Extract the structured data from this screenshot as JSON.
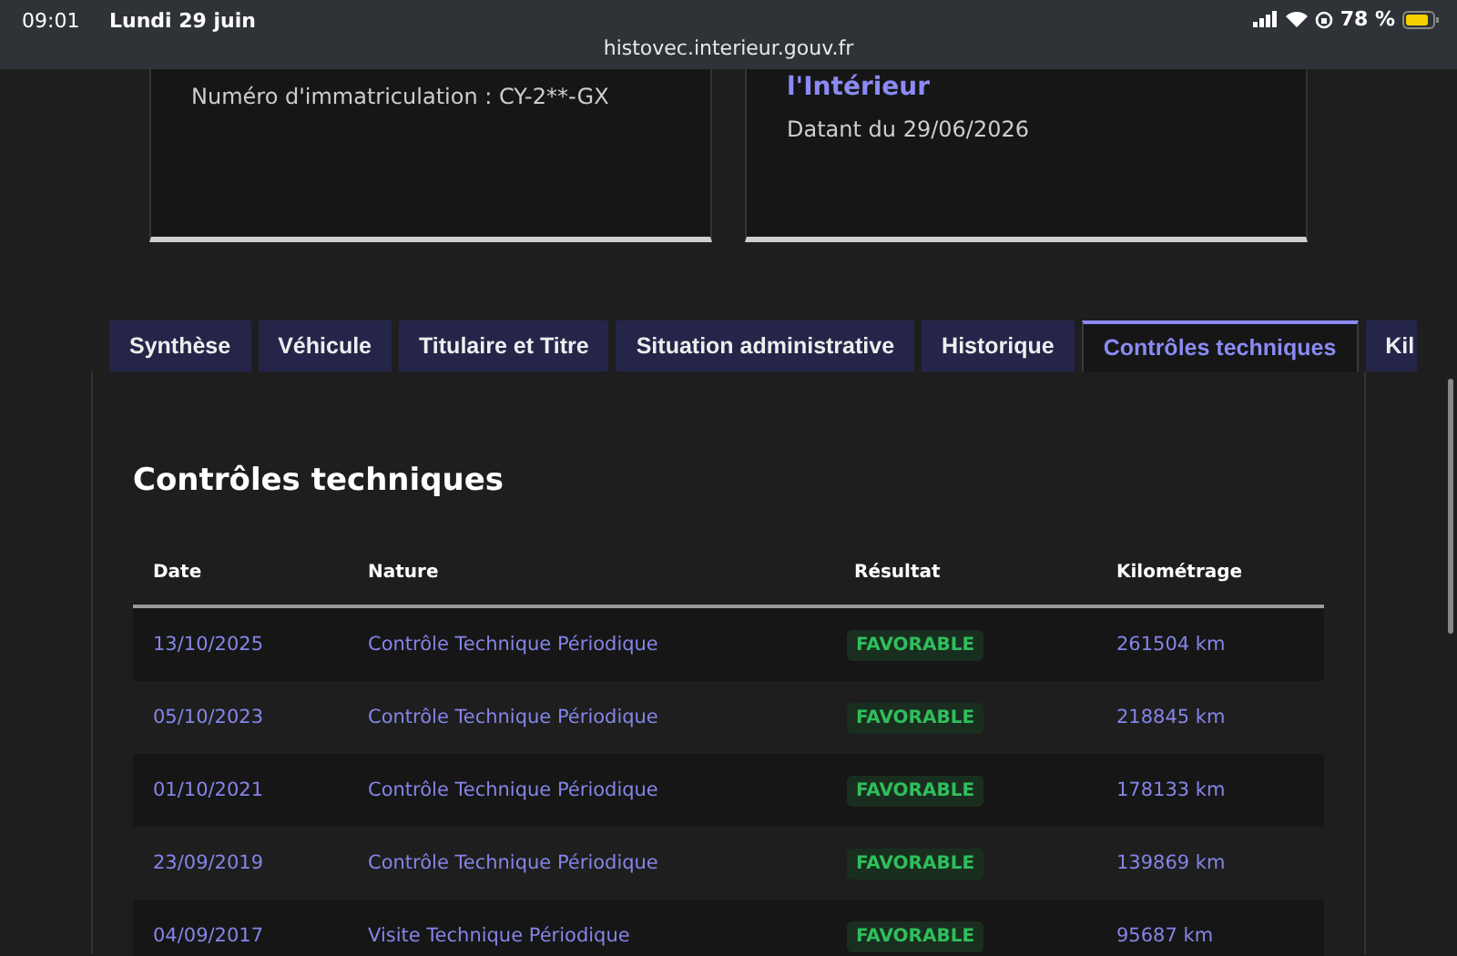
{
  "status_bar": {
    "time": "09:01",
    "date": "Lundi 29 juin",
    "battery": "78 %",
    "url": "histovec.interieur.gouv.fr"
  },
  "cards": [
    {
      "lines": [
        {
          "kind": "text",
          "text": "Numéro d'immatriculation : CY-2**-GX"
        }
      ]
    },
    {
      "lines": [
        {
          "kind": "heading",
          "text": "l'Intérieur"
        },
        {
          "kind": "text",
          "text": "Datant du 29/06/2026"
        }
      ]
    }
  ],
  "tabs": [
    {
      "label": "Synthèse",
      "selected": false
    },
    {
      "label": "Véhicule",
      "selected": false
    },
    {
      "label": "Titulaire et Titre",
      "selected": false
    },
    {
      "label": "Situation administrative",
      "selected": false
    },
    {
      "label": "Historique",
      "selected": false
    },
    {
      "label": "Contrôles techniques",
      "selected": true
    },
    {
      "label": "Kil",
      "selected": false
    }
  ],
  "section_title": "Contrôles techniques",
  "table": {
    "columns": [
      "Date",
      "Nature",
      "Résultat",
      "Kilométrage"
    ],
    "rows": [
      {
        "date": "13/10/2025",
        "nature": "Contrôle Technique Périodique",
        "result": "FAVORABLE",
        "mileage": "261504 km"
      },
      {
        "date": "05/10/2023",
        "nature": "Contrôle Technique Périodique",
        "result": "FAVORABLE",
        "mileage": "218845 km"
      },
      {
        "date": "01/10/2021",
        "nature": "Contrôle Technique Périodique",
        "result": "FAVORABLE",
        "mileage": "178133 km"
      },
      {
        "date": "23/09/2019",
        "nature": "Contrôle Technique Périodique",
        "result": "FAVORABLE",
        "mileage": "139869 km"
      },
      {
        "date": "04/09/2017",
        "nature": "Visite Technique Périodique",
        "result": "FAVORABLE",
        "mileage": "95687 km"
      }
    ]
  }
}
